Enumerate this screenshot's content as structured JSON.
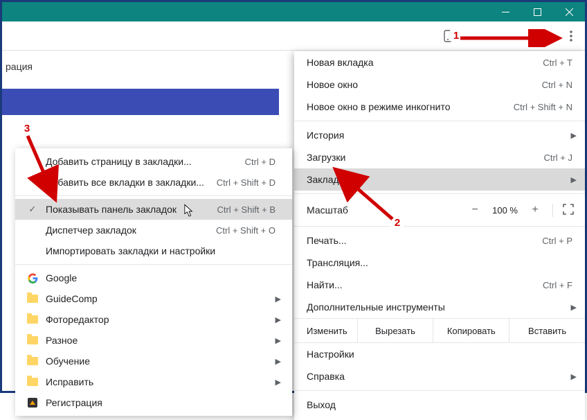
{
  "window": {
    "min_icon": "−",
    "max_icon": "◻",
    "close_icon": "✕"
  },
  "bg_text": "рация",
  "menu": {
    "new_tab": {
      "label": "Новая вкладка",
      "shortcut": "Ctrl + T"
    },
    "new_window": {
      "label": "Новое окно",
      "shortcut": "Ctrl + N"
    },
    "incognito": {
      "label": "Новое окно в режиме инкогнито",
      "shortcut": "Ctrl + Shift + N"
    },
    "history": {
      "label": "История"
    },
    "downloads": {
      "label": "Загрузки",
      "shortcut": "Ctrl + J"
    },
    "bookmarks": {
      "label": "Закладки"
    },
    "zoom": {
      "label": "Масштаб",
      "minus": "−",
      "value": "100 %",
      "plus": "+"
    },
    "print": {
      "label": "Печать...",
      "shortcut": "Ctrl + P"
    },
    "cast": {
      "label": "Трансляция..."
    },
    "find": {
      "label": "Найти...",
      "shortcut": "Ctrl + F"
    },
    "tools": {
      "label": "Дополнительные инструменты"
    },
    "edit": {
      "label": "Изменить",
      "cut": "Вырезать",
      "copy": "Копировать",
      "paste": "Вставить"
    },
    "settings": {
      "label": "Настройки"
    },
    "help": {
      "label": "Справка"
    },
    "exit": {
      "label": "Выход"
    }
  },
  "submenu": {
    "add_page": {
      "label": "Добавить страницу в закладки...",
      "shortcut": "Ctrl + D"
    },
    "add_all": {
      "label": "Добавить все вкладки в закладки...",
      "shortcut": "Ctrl + Shift + D"
    },
    "show_bar": {
      "label": "Показывать панель закладок",
      "shortcut": "Ctrl + Shift + B"
    },
    "manager": {
      "label": "Диспетчер закладок",
      "shortcut": "Ctrl + Shift + O"
    },
    "import": {
      "label": "Импортировать закладки и настройки"
    },
    "folders": [
      {
        "label": "Google",
        "type": "google"
      },
      {
        "label": "GuideComp",
        "type": "folder"
      },
      {
        "label": "Фоторедактор",
        "type": "folder"
      },
      {
        "label": "Разное",
        "type": "folder"
      },
      {
        "label": "Обучение",
        "type": "folder"
      },
      {
        "label": "Исправить",
        "type": "folder"
      },
      {
        "label": "Регистрация",
        "type": "avast"
      }
    ]
  },
  "annotations": {
    "n1": "1",
    "n2": "2",
    "n3": "3"
  }
}
